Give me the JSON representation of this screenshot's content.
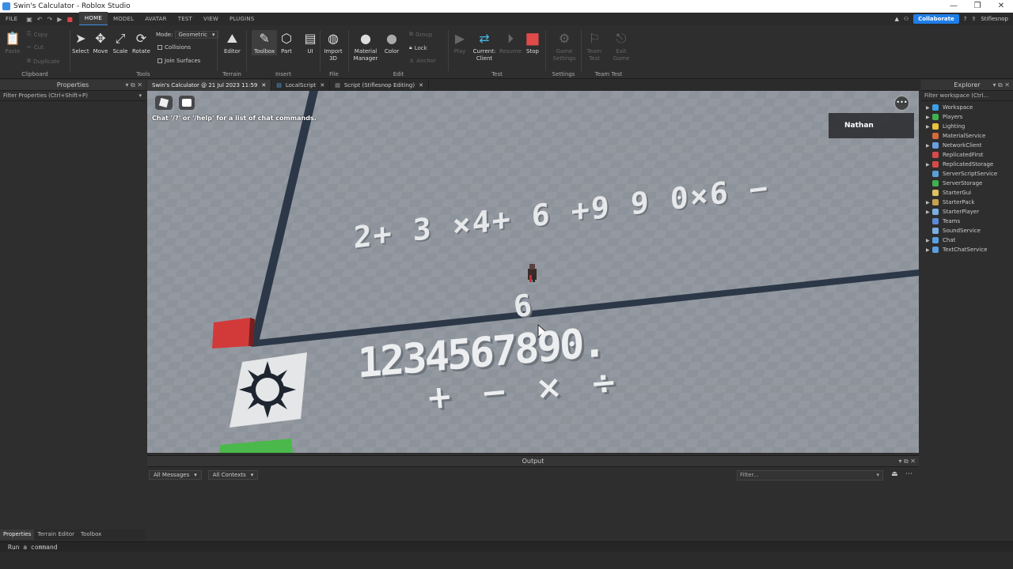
{
  "window": {
    "title": "Swin's Calculator - Roblox Studio",
    "controls": [
      "—",
      "❐",
      "✕"
    ]
  },
  "menu": {
    "file": "FILE",
    "tabs": [
      "HOME",
      "MODEL",
      "AVATAR",
      "TEST",
      "VIEW",
      "PLUGINS"
    ],
    "collaborate": "Collaborate",
    "user": "Stiflesnop"
  },
  "ribbon": {
    "clipboard": {
      "label": "Clipboard",
      "paste": "Paste",
      "copy": "Copy",
      "cut": "Cut",
      "duplicate": "Duplicate"
    },
    "tools": {
      "label": "Tools",
      "select": "Select",
      "move": "Move",
      "scale": "Scale",
      "rotate": "Rotate",
      "mode_label": "Mode:",
      "mode_value": "Geometric",
      "collisions": "Collisions",
      "join_surfaces": "Join Surfaces"
    },
    "terrain": {
      "label": "Terrain",
      "editor": "Editor"
    },
    "insert": {
      "label": "Insert",
      "toolbox": "Toolbox",
      "part": "Part",
      "ui": "UI"
    },
    "file": {
      "label": "File",
      "import3d": "Import 3D"
    },
    "edit": {
      "label": "Edit",
      "material_manager": "Material Manager",
      "color": "Color",
      "group": "Group",
      "lock": "Lock",
      "anchor": "Anchor"
    },
    "test": {
      "label": "Test",
      "play": "Play",
      "current_client": "Current: Client",
      "resume": "Resume",
      "stop": "Stop"
    },
    "settings": {
      "label": "Settings",
      "game_settings": "Game Settings"
    },
    "team_test": {
      "label": "Team Test",
      "team_test": "Team Test",
      "exit_game": "Exit Game"
    }
  },
  "properties": {
    "title": "Properties",
    "filter": "Filter Properties (Ctrl+Shift+P)"
  },
  "doc_tabs": [
    {
      "label": "Swin's Calculator @ 21 Jul 2023 11:59"
    },
    {
      "label": "LocalScript"
    },
    {
      "label": "Script (Stiflesnop Editing)"
    }
  ],
  "viewport": {
    "chat_hint": "Chat '/?' or '/help' for a list of chat commands.",
    "player_name": "Nathan",
    "expression": "2+ 3 ×4+ 6 +9 9 0×6 −",
    "result": "6",
    "digits": "1234567890.",
    "operators": "+ − × ÷"
  },
  "explorer": {
    "title": "Explorer",
    "filter": "Filter workspace (Ctrl...",
    "items": [
      {
        "label": "Workspace",
        "color": "#3aa0e8",
        "expand": true
      },
      {
        "label": "Players",
        "color": "#3fb24f",
        "expand": true
      },
      {
        "label": "Lighting",
        "color": "#e8c23a",
        "expand": true
      },
      {
        "label": "MaterialService",
        "color": "#d26a3a",
        "expand": false
      },
      {
        "label": "NetworkClient",
        "color": "#6aa0e0",
        "expand": true
      },
      {
        "label": "ReplicatedFirst",
        "color": "#d84a4a",
        "expand": false
      },
      {
        "label": "ReplicatedStorage",
        "color": "#d84a4a",
        "expand": true
      },
      {
        "label": "ServerScriptService",
        "color": "#5aa0d8",
        "expand": false
      },
      {
        "label": "ServerStorage",
        "color": "#3fb24f",
        "expand": false
      },
      {
        "label": "StarterGui",
        "color": "#e0c060",
        "expand": false
      },
      {
        "label": "StarterPack",
        "color": "#c8a050",
        "expand": true
      },
      {
        "label": "StarterPlayer",
        "color": "#7ab0e0",
        "expand": true
      },
      {
        "label": "Teams",
        "color": "#5a8ad8",
        "expand": false
      },
      {
        "label": "SoundService",
        "color": "#7ab0e0",
        "expand": false
      },
      {
        "label": "Chat",
        "color": "#5aa0e0",
        "expand": true
      },
      {
        "label": "TextChatService",
        "color": "#5aa0e0",
        "expand": true
      }
    ]
  },
  "output": {
    "title": "Output",
    "messages_filter": "All Messages",
    "contexts_filter": "All Contexts",
    "filter_placeholder": "Filter..."
  },
  "bottom_tabs": [
    "Properties",
    "Terrain Editor",
    "Toolbox"
  ],
  "command_bar": {
    "placeholder": "Run a command"
  }
}
